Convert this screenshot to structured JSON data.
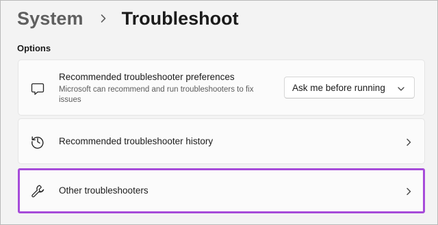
{
  "breadcrumb": {
    "parent": "System",
    "current": "Troubleshoot"
  },
  "section": {
    "label": "Options"
  },
  "rows": [
    {
      "icon": "chat-bubble-icon",
      "title": "Recommended troubleshooter preferences",
      "description": "Microsoft can recommend and run troubleshooters to fix issues",
      "dropdown_value": "Ask me before running"
    },
    {
      "icon": "history-icon",
      "title": "Recommended troubleshooter history"
    },
    {
      "icon": "wrench-icon",
      "title": "Other troubleshooters",
      "highlight_color": "#a64bd9"
    }
  ],
  "colors": {
    "background": "#f3f3f3",
    "card": "#fbfbfb",
    "highlight": "#a64bd9"
  }
}
